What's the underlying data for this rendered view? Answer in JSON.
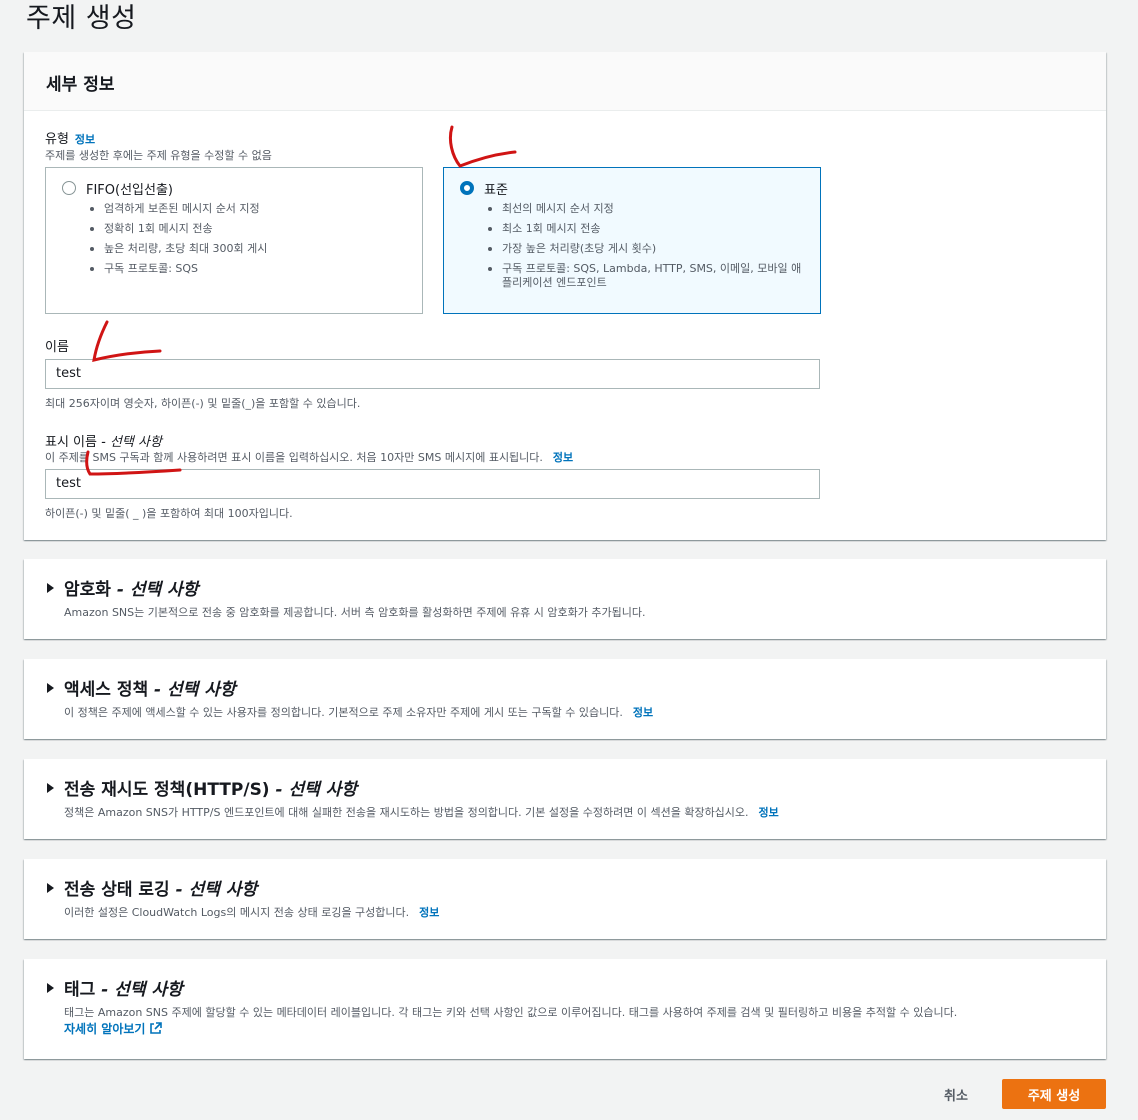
{
  "page_title": "주제 생성",
  "details": {
    "header": "세부 정보",
    "type_label": "유형",
    "type_info": "정보",
    "type_desc": "주제를 생성한 후에는 주제 유형을 수정할 수 없음",
    "fifo": {
      "title": "FIFO(선입선출)",
      "bullets": [
        "엄격하게 보존된 메시지 순서 지정",
        "정확히 1회 메시지 전송",
        "높은 처리량, 초당 최대 300회 게시",
        "구독 프로토콜: SQS"
      ],
      "selected": false
    },
    "standard": {
      "title": "표준",
      "bullets": [
        "최선의 메시지 순서 지정",
        "최소 1회 메시지 전송",
        "가장 높은 처리량(초당 게시 횟수)",
        "구독 프로토콜: SQS, Lambda, HTTP, SMS, 이메일, 모바일 애플리케이션 엔드포인트"
      ],
      "selected": true
    },
    "name_label": "이름",
    "name_value": "test",
    "name_hint": "최대 256자이며 영숫자, 하이픈(-) 및 밑줄(_)을 포함할 수 있습니다.",
    "display_label": "표시 이름",
    "display_optional": " - 선택 사항",
    "display_desc": "이 주제를 SMS 구독과 함께 사용하려면 표시 이름을 입력하십시오. 처음 10자만 SMS 메시지에 표시됩니다.",
    "display_info": "정보",
    "display_value": "test",
    "display_hint": "하이픈(-) 및 밑줄( _ )을 포함하여 최대 100자입니다."
  },
  "sections": {
    "encryption": {
      "title": "암호화",
      "optional": " - 선택 사항",
      "desc": "Amazon SNS는 기본적으로 전송 중 암호화를 제공합니다. 서버 측 암호화를 활성화하면 주제에 유휴 시 암호화가 추가됩니다."
    },
    "access": {
      "title": "액세스 정책",
      "optional": " - 선택 사항",
      "desc": "이 정책은 주제에 액세스할 수 있는 사용자를 정의합니다. 기본적으로 주제 소유자만 주제에 게시 또는 구독할 수 있습니다.",
      "info": "정보"
    },
    "retry": {
      "title": "전송 재시도 정책(HTTP/S)",
      "optional": " - 선택 사항",
      "desc": "정책은 Amazon SNS가 HTTP/S 엔드포인트에 대해 실패한 전송을 재시도하는 방법을 정의합니다. 기본 설정을 수정하려면 이 섹션을 확장하십시오.",
      "info": "정보"
    },
    "logging": {
      "title": "전송 상태 로깅",
      "optional": " - 선택 사항",
      "desc": "이러한 설정은 CloudWatch Logs의 메시지 전송 상태 로깅을 구성합니다.",
      "info": "정보"
    },
    "tags": {
      "title": "태그",
      "optional": " - 선택 사항",
      "desc": "태그는 Amazon SNS 주제에 할당할 수 있는 메타데이터 레이블입니다. 각 태그는 키와 선택 사항인 값으로 이루어집니다. 태그를 사용하여 주제를 검색 및 필터링하고 비용을 추적할 수 있습니다.",
      "learn_more": "자세히 알아보기"
    }
  },
  "footer": {
    "cancel": "취소",
    "create": "주제 생성"
  },
  "icons": [
    "caret-right-icon",
    "external-link-icon",
    "radio-icon"
  ],
  "colors": {
    "accent": "#0073bb",
    "primary_button": "#ec7211",
    "annotation": "#d01414"
  }
}
